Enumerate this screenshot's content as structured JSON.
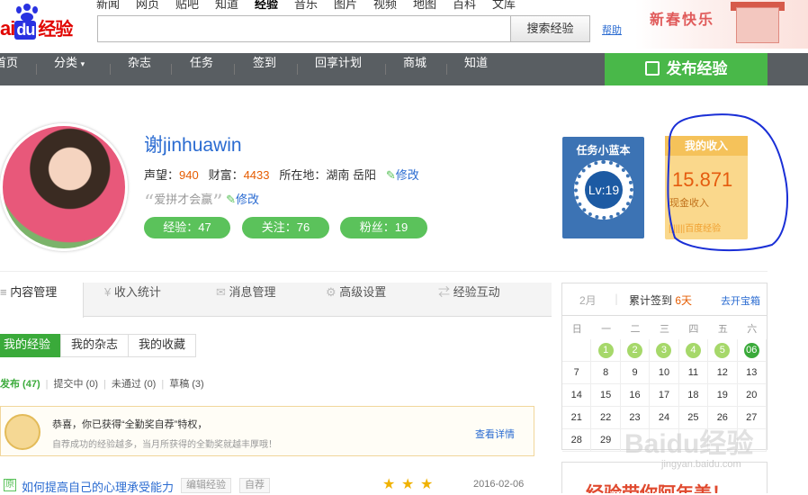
{
  "header": {
    "logo": {
      "brand_a": "ai",
      "brand_b": "du",
      "brand_c": "经验"
    },
    "topnav": [
      {
        "label": "新闻"
      },
      {
        "label": "网页"
      },
      {
        "label": "贴吧"
      },
      {
        "label": "知道"
      },
      {
        "label": "经验",
        "active": true
      },
      {
        "label": "音乐"
      },
      {
        "label": "图片"
      },
      {
        "label": "视频"
      },
      {
        "label": "地图"
      },
      {
        "label": "百科"
      },
      {
        "label": "文库"
      }
    ],
    "search": {
      "value": "",
      "button": "搜索经验"
    },
    "help": "帮助",
    "banner": "新春快乐"
  },
  "nav": {
    "items": [
      "首页",
      "分类",
      "杂志",
      "任务",
      "签到",
      "回享计划",
      "商城",
      "知道"
    ],
    "publish": "发布经验"
  },
  "profile": {
    "name": "谢jinhuawin",
    "reputation_label": "声望：",
    "reputation": "940",
    "wealth_label": "财富：",
    "wealth": "4433",
    "location_label": "所在地：",
    "location": "湖南 岳阳",
    "edit": "修改",
    "motto_open": "“",
    "motto": "爱拼才会赢",
    "motto_close": "”",
    "motto_edit": "修改",
    "pills": [
      "经验：47",
      "关注：76",
      "粉丝：19"
    ]
  },
  "task_badge": {
    "title": "任务小蓝本",
    "level": "Lv:19"
  },
  "income": {
    "title": "我的收入",
    "value": "15.871",
    "label": "现金收入",
    "footer": "百度经验"
  },
  "content": {
    "tabs": [
      {
        "label": "内容管理",
        "icon": "list-icon"
      },
      {
        "label": "收入统计",
        "icon": "yen-icon"
      },
      {
        "label": "消息管理",
        "icon": "mail-icon"
      },
      {
        "label": "高级设置",
        "icon": "gear-icon"
      },
      {
        "label": "经验互动",
        "icon": "exchange-icon"
      }
    ],
    "subtabs": [
      "我的经验",
      "我的杂志",
      "我的收藏"
    ],
    "filters": [
      {
        "label": "发布 (47)",
        "active": true
      },
      {
        "label": "提交中 (0)"
      },
      {
        "label": "未通过 (0)"
      },
      {
        "label": "草稿 (3)"
      }
    ],
    "notice": {
      "line1": "恭喜，你已获得“全勤奖自荐”特权，",
      "line2": "自荐成功的经验越多，当月所获得的全勤奖就越丰厚哦！",
      "link": "查看详情"
    },
    "rows": [
      {
        "badge": "原",
        "title": "如何提高自己的心理承受能力",
        "edit_tag": "编辑经验",
        "self_tag": "自荐",
        "stars": 3,
        "date": "2016-02-06"
      }
    ]
  },
  "calendar": {
    "month": "2月",
    "signin_label": "累计签到",
    "signin_days": "6天",
    "go": "去开宝箱",
    "weekdays": [
      "日",
      "一",
      "二",
      "三",
      "四",
      "五",
      "六"
    ],
    "weeks": [
      [
        "",
        "1",
        "2",
        "3",
        "4",
        "5",
        "06"
      ],
      [
        "7",
        "8",
        "9",
        "10",
        "11",
        "12",
        "13"
      ],
      [
        "14",
        "15",
        "16",
        "17",
        "18",
        "19",
        "20"
      ],
      [
        "21",
        "22",
        "23",
        "24",
        "25",
        "26",
        "27"
      ],
      [
        "28",
        "29",
        "",
        "",
        "",
        "",
        ""
      ]
    ],
    "signed": [
      "1",
      "2",
      "3",
      "4",
      "5",
      "06"
    ],
    "today": "06"
  },
  "promo": "经验带你阿年美！",
  "watermark": {
    "text": "Baidu经验",
    "url": "jingyan.baidu.com"
  },
  "colors": {
    "accent": "#49b849",
    "link": "#2a6bd1",
    "nav_bg": "#595e62",
    "highlight": "#e65c00"
  }
}
